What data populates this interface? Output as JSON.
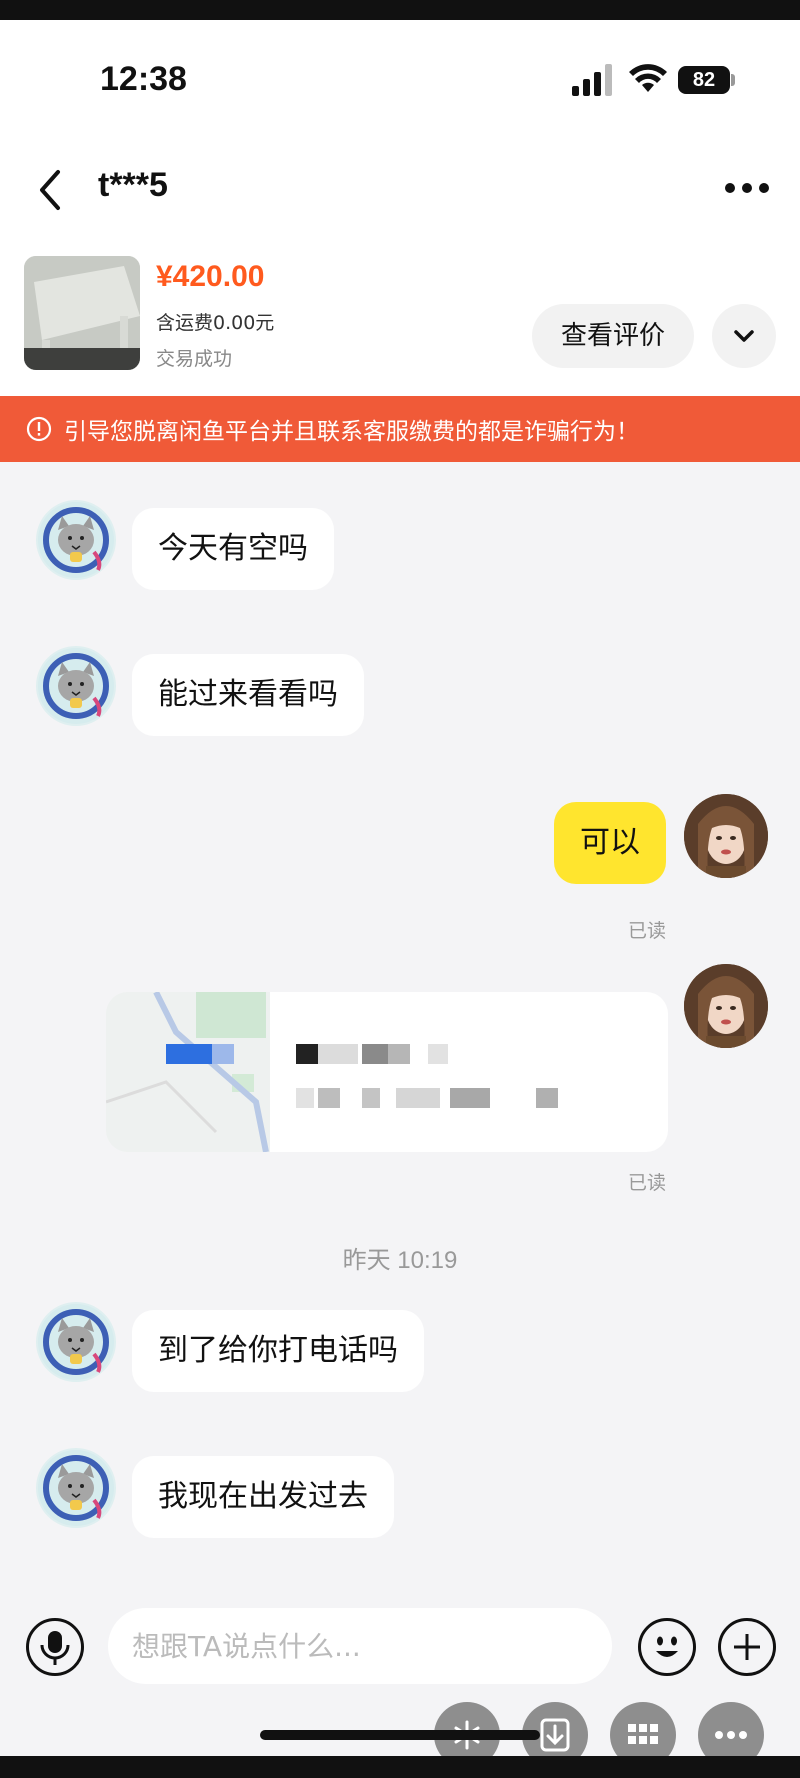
{
  "status_bar": {
    "time": "12:38",
    "battery": "82"
  },
  "header": {
    "title": "t***5"
  },
  "product": {
    "price": "¥420.00",
    "shipping": "含运费0.00元",
    "status": "交易成功",
    "review_button": "查看评价"
  },
  "warning": "引导您脱离闲鱼平台并且联系客服缴费的都是诈骗行为！",
  "messages": [
    {
      "from": "other",
      "text": "今天有空吗"
    },
    {
      "from": "other",
      "text": "能过来看看吗"
    },
    {
      "from": "me",
      "text": "可以",
      "receipt": "已读"
    },
    {
      "from": "me",
      "type": "location",
      "receipt": "已读"
    },
    {
      "from": "other",
      "text": "到了给你打电话吗"
    },
    {
      "from": "other",
      "text": "我现在出发过去"
    }
  ],
  "time_divider": "昨天 10:19",
  "composer": {
    "placeholder": "想跟TA说点什么..."
  },
  "colors": {
    "price": "#ff5a1e",
    "banner": "#f05a38",
    "my_bubble": "#ffe52e"
  }
}
